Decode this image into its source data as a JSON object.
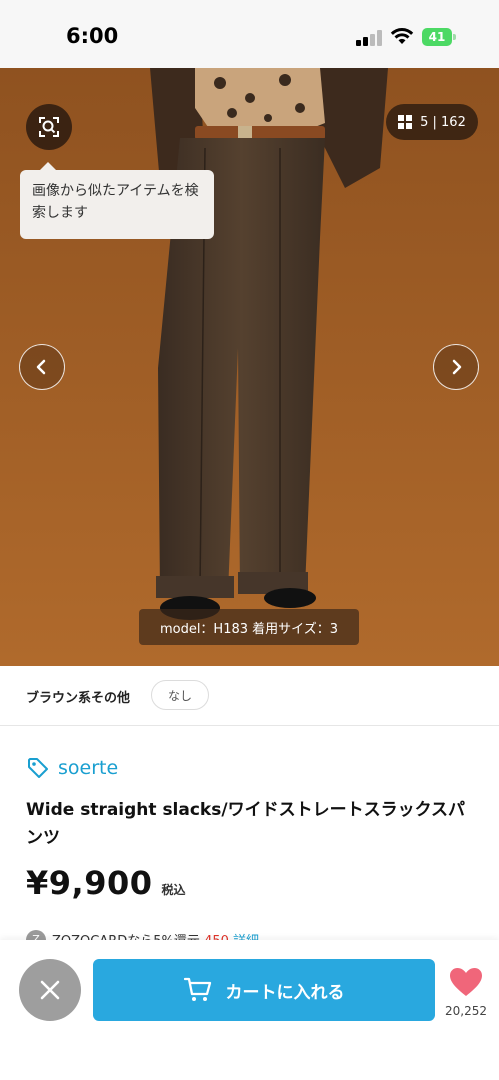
{
  "status_bar": {
    "time": "6:00",
    "battery": "41"
  },
  "gallery": {
    "tooltip": "画像から似たアイテムを検索します",
    "counter": "5 | 162",
    "model_caption": "model：H183 着用サイズ：3"
  },
  "color": {
    "label": "ブラウン系その他",
    "chip": "なし"
  },
  "product": {
    "brand": "soerte",
    "name": "Wide straight slacks/ワイドストレートスラックスパンツ",
    "price": "¥9,900",
    "tax_label": "税込",
    "cashback_icon": "Z",
    "cashback_text": "ZOZOCARDなら5%還元",
    "cashback_points": "450",
    "cashback_link": "詳細"
  },
  "actions": {
    "cart_label": "カートに入れる",
    "favorite_count": "20,252"
  },
  "colors": {
    "accent": "#29a8df",
    "brand": "#1a9fd0",
    "heart": "#f0667a",
    "background_photo": "#a45f24"
  },
  "icons": [
    "image-search-icon",
    "grid-icon",
    "chevron-left-icon",
    "chevron-right-icon",
    "tag-icon",
    "close-icon",
    "cart-icon",
    "heart-icon"
  ]
}
